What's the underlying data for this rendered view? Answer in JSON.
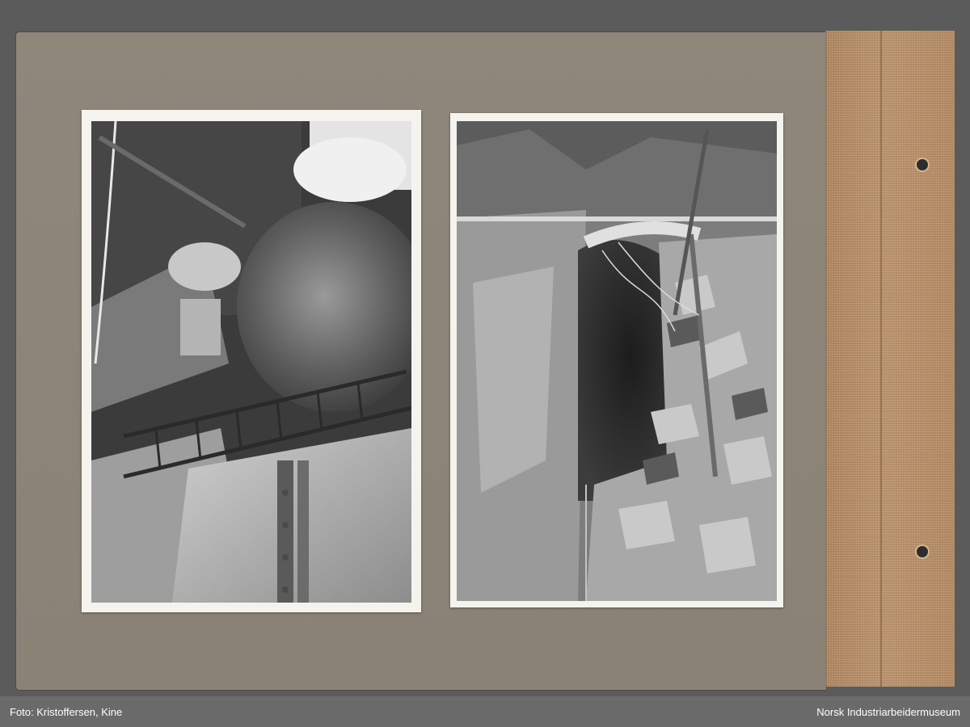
{
  "caption": {
    "photographer": "Foto: Kristoffersen, Kine",
    "museum": "Norsk Industriarbeidermuseum"
  },
  "photos": [
    {
      "subject": "machinery-with-ladder"
    },
    {
      "subject": "rock-tunnel"
    }
  ]
}
